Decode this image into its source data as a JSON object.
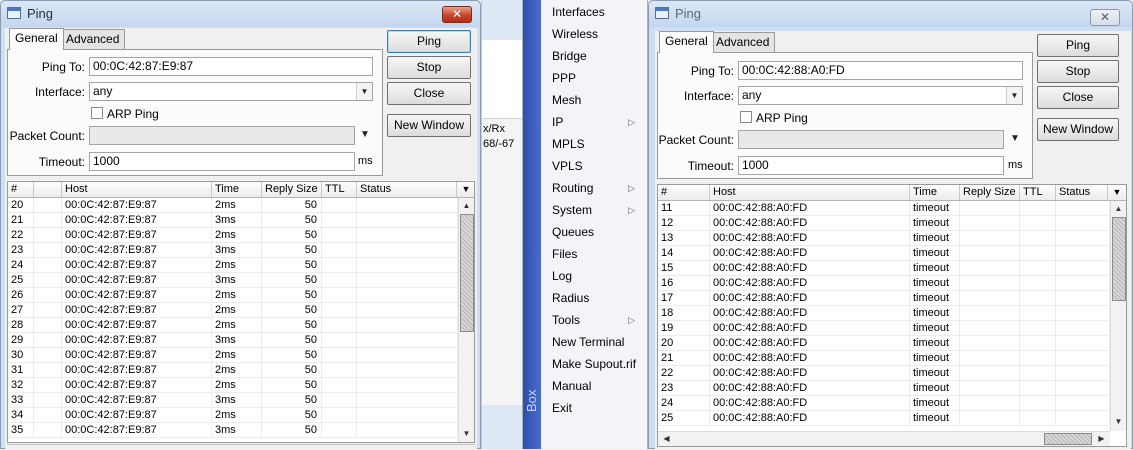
{
  "left_window": {
    "title": "Ping",
    "close_glyph": "✕",
    "tabs": [
      "General",
      "Advanced"
    ],
    "form": {
      "ping_to_label": "Ping To:",
      "ping_to_value": "00:0C:42:87:E9:87",
      "interface_label": "Interface:",
      "interface_value": "any",
      "arp_ping_label": "ARP Ping",
      "packet_count_label": "Packet Count:",
      "packet_count_value": "",
      "timeout_label": "Timeout:",
      "timeout_value": "1000",
      "timeout_unit": "ms"
    },
    "buttons": {
      "ping": "Ping",
      "stop": "Stop",
      "close": "Close",
      "new_window": "New Window"
    },
    "columns": [
      "#",
      "",
      "Host",
      "Time",
      "Reply Size",
      "TTL",
      "Status"
    ],
    "rows": [
      [
        "20",
        "00:0C:42:87:E9:87",
        "2ms",
        "50"
      ],
      [
        "21",
        "00:0C:42:87:E9:87",
        "3ms",
        "50"
      ],
      [
        "22",
        "00:0C:42:87:E9:87",
        "2ms",
        "50"
      ],
      [
        "23",
        "00:0C:42:87:E9:87",
        "3ms",
        "50"
      ],
      [
        "24",
        "00:0C:42:87:E9:87",
        "2ms",
        "50"
      ],
      [
        "25",
        "00:0C:42:87:E9:87",
        "3ms",
        "50"
      ],
      [
        "26",
        "00:0C:42:87:E9:87",
        "2ms",
        "50"
      ],
      [
        "27",
        "00:0C:42:87:E9:87",
        "2ms",
        "50"
      ],
      [
        "28",
        "00:0C:42:87:E9:87",
        "2ms",
        "50"
      ],
      [
        "29",
        "00:0C:42:87:E9:87",
        "3ms",
        "50"
      ],
      [
        "30",
        "00:0C:42:87:E9:87",
        "2ms",
        "50"
      ],
      [
        "31",
        "00:0C:42:87:E9:87",
        "2ms",
        "50"
      ],
      [
        "32",
        "00:0C:42:87:E9:87",
        "2ms",
        "50"
      ],
      [
        "33",
        "00:0C:42:87:E9:87",
        "3ms",
        "50"
      ],
      [
        "34",
        "00:0C:42:87:E9:87",
        "2ms",
        "50"
      ],
      [
        "35",
        "00:0C:42:87:E9:87",
        "3ms",
        "50"
      ]
    ]
  },
  "background_fragment": {
    "line1": "x/Rx",
    "line2": "68/-67"
  },
  "menu": {
    "brand": "Box",
    "items": [
      {
        "label": "Interfaces",
        "sub": false
      },
      {
        "label": "Wireless",
        "sub": false
      },
      {
        "label": "Bridge",
        "sub": false
      },
      {
        "label": "PPP",
        "sub": false
      },
      {
        "label": "Mesh",
        "sub": false
      },
      {
        "label": "IP",
        "sub": true
      },
      {
        "label": "MPLS",
        "sub": false
      },
      {
        "label": "VPLS",
        "sub": false
      },
      {
        "label": "Routing",
        "sub": true
      },
      {
        "label": "System",
        "sub": true
      },
      {
        "label": "Queues",
        "sub": false
      },
      {
        "label": "Files",
        "sub": false
      },
      {
        "label": "Log",
        "sub": false
      },
      {
        "label": "Radius",
        "sub": false
      },
      {
        "label": "Tools",
        "sub": true
      },
      {
        "label": "New Terminal",
        "sub": false
      },
      {
        "label": "Make Supout.rif",
        "sub": false
      },
      {
        "label": "Manual",
        "sub": false
      },
      {
        "label": "Exit",
        "sub": false
      }
    ]
  },
  "right_window": {
    "title": "Ping",
    "close_glyph": "✕",
    "tabs": [
      "General",
      "Advanced"
    ],
    "form": {
      "ping_to_label": "Ping To:",
      "ping_to_value": "00:0C:42:88:A0:FD",
      "interface_label": "Interface:",
      "interface_value": "any",
      "arp_ping_label": "ARP Ping",
      "packet_count_label": "Packet Count:",
      "packet_count_value": "",
      "timeout_label": "Timeout:",
      "timeout_value": "1000",
      "timeout_unit": "ms"
    },
    "buttons": {
      "ping": "Ping",
      "stop": "Stop",
      "close": "Close",
      "new_window": "New Window"
    },
    "columns": [
      "#",
      "Host",
      "Time",
      "Reply Size",
      "TTL",
      "Status"
    ],
    "rows": [
      [
        "11",
        "00:0C:42:88:A0:FD",
        "timeout"
      ],
      [
        "12",
        "00:0C:42:88:A0:FD",
        "timeout"
      ],
      [
        "13",
        "00:0C:42:88:A0:FD",
        "timeout"
      ],
      [
        "14",
        "00:0C:42:88:A0:FD",
        "timeout"
      ],
      [
        "15",
        "00:0C:42:88:A0:FD",
        "timeout"
      ],
      [
        "16",
        "00:0C:42:88:A0:FD",
        "timeout"
      ],
      [
        "17",
        "00:0C:42:88:A0:FD",
        "timeout"
      ],
      [
        "18",
        "00:0C:42:88:A0:FD",
        "timeout"
      ],
      [
        "19",
        "00:0C:42:88:A0:FD",
        "timeout"
      ],
      [
        "20",
        "00:0C:42:88:A0:FD",
        "timeout"
      ],
      [
        "21",
        "00:0C:42:88:A0:FD",
        "timeout"
      ],
      [
        "22",
        "00:0C:42:88:A0:FD",
        "timeout"
      ],
      [
        "23",
        "00:0C:42:88:A0:FD",
        "timeout"
      ],
      [
        "24",
        "00:0C:42:88:A0:FD",
        "timeout"
      ],
      [
        "25",
        "00:0C:42:88:A0:FD",
        "timeout"
      ]
    ]
  },
  "colors": {
    "frame": "#cfdff1",
    "menu_strip": "#2d4da9",
    "close_active": "#c8452b"
  }
}
